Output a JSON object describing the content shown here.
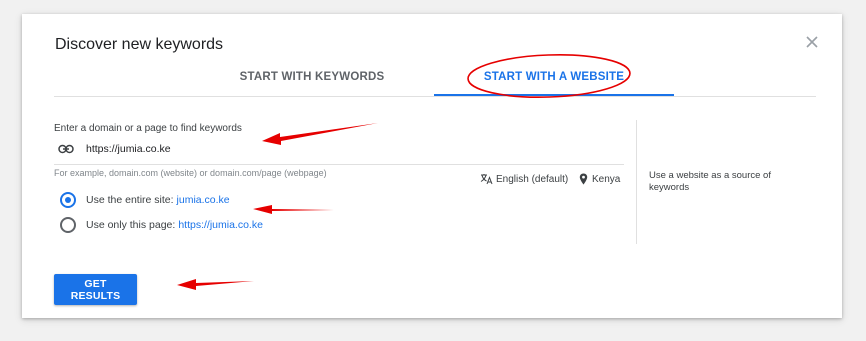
{
  "dialog": {
    "title": "Discover new keywords",
    "close_icon": "close-icon"
  },
  "tabs": [
    {
      "label": "START WITH KEYWORDS",
      "active": false
    },
    {
      "label": "START WITH A WEBSITE",
      "active": true
    }
  ],
  "form": {
    "label": "Enter a domain or a page to find keywords",
    "url_value": "https://jumia.co.ke",
    "hint": "For example, domain.com (website) or domain.com/page (webpage)",
    "language": "English (default)",
    "location": "Kenya",
    "options": [
      {
        "label": "Use the entire site:",
        "link": "jumia.co.ke",
        "selected": true
      },
      {
        "label": "Use only this page:",
        "link": "https://jumia.co.ke",
        "selected": false
      }
    ]
  },
  "side_help": "Use a website as a source of keywords",
  "actions": {
    "get_results": "GET RESULTS"
  },
  "colors": {
    "accent": "#1a73e8",
    "annotation": "#e60000"
  }
}
